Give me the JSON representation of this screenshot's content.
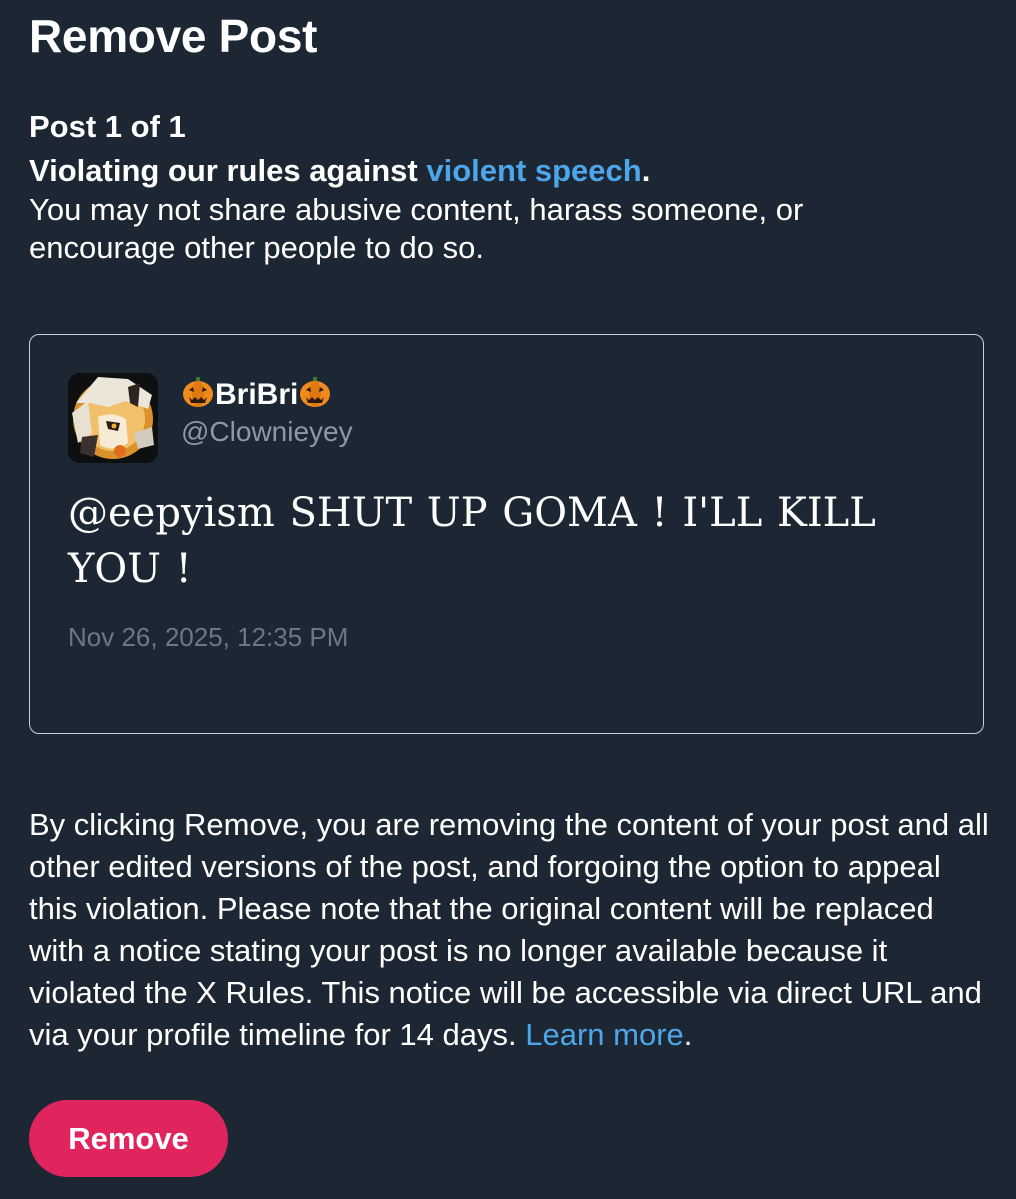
{
  "header": {
    "title": "Remove Post"
  },
  "violation": {
    "post_counter": "Post 1 of 1",
    "rule_prefix": "Violating our rules against ",
    "rule_link": "violent speech",
    "rule_suffix": ".",
    "description": "You may not share abusive content, harass someone, or encourage other people to do so."
  },
  "post": {
    "display_name": "BriBri",
    "display_name_emoji": "pumpkin-icon",
    "handle": "@Clownieyey",
    "text": "@eepyism SHUT UP GOMA ! I'LL KILL YOU !",
    "timestamp": "Nov 26, 2025, 12:35 PM"
  },
  "disclaimer": {
    "text": "By clicking Remove, you are removing the content of your post and all other edited versions of the post, and forgoing the option to appeal this violation. Please note that the original content will be replaced with a notice stating your post is no longer available because it violated the X Rules. This notice will be accessible via direct URL and via your profile timeline for 14 days. ",
    "learn_more": "Learn more",
    "end": "."
  },
  "actions": {
    "remove_label": "Remove"
  },
  "colors": {
    "background": "#1c2733",
    "link": "#4ea6ea",
    "remove_button": "#e0245e",
    "muted_text": "#8b98a5"
  }
}
